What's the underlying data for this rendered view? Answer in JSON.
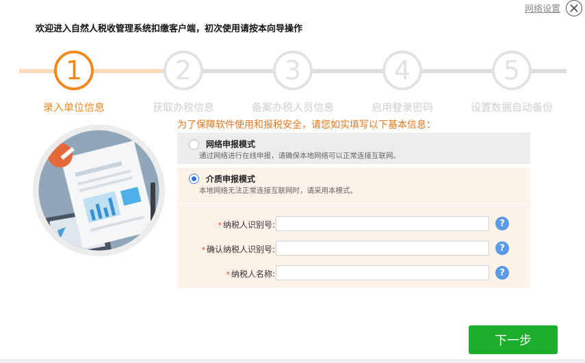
{
  "header": {
    "network_settings": "网络设置",
    "welcome": "欢迎进入自然人税收管理系统扣缴客户端，初次使用请按本向导操作"
  },
  "steps": [
    {
      "number": "1",
      "label": "录入单位信息",
      "active": true
    },
    {
      "number": "2",
      "label": "获取办税信息",
      "active": false
    },
    {
      "number": "3",
      "label": "备案办税人员信息",
      "active": false
    },
    {
      "number": "4",
      "label": "启用登录密码",
      "active": false
    },
    {
      "number": "5",
      "label": "设置数据自动备份",
      "active": false
    }
  ],
  "notice": "为了保障软件使用和报税安全，请您如实填写以下基本信息：",
  "options": {
    "network": {
      "title": "网络申报模式",
      "desc": "通过网络进行在线申报，请确保本地网络可以正常连接互联网。",
      "selected": false
    },
    "media": {
      "title": "介质申报模式",
      "desc": "本地网络无法正常连接互联网时，请采用本模式。",
      "selected": true
    }
  },
  "fields": [
    {
      "label": "纳税人识别号:",
      "value": "",
      "required": "*"
    },
    {
      "label": "确认纳税人识别号:",
      "value": "",
      "required": "*"
    },
    {
      "label": "纳税人名称:",
      "value": "",
      "required": "*"
    }
  ],
  "help_glyph": "?",
  "next_button": "下一步",
  "colors": {
    "accent": "#f08a1c",
    "inactive": "#dcdcdc",
    "primary_button": "#1aae2a",
    "help_icon": "#5b9ae8"
  }
}
